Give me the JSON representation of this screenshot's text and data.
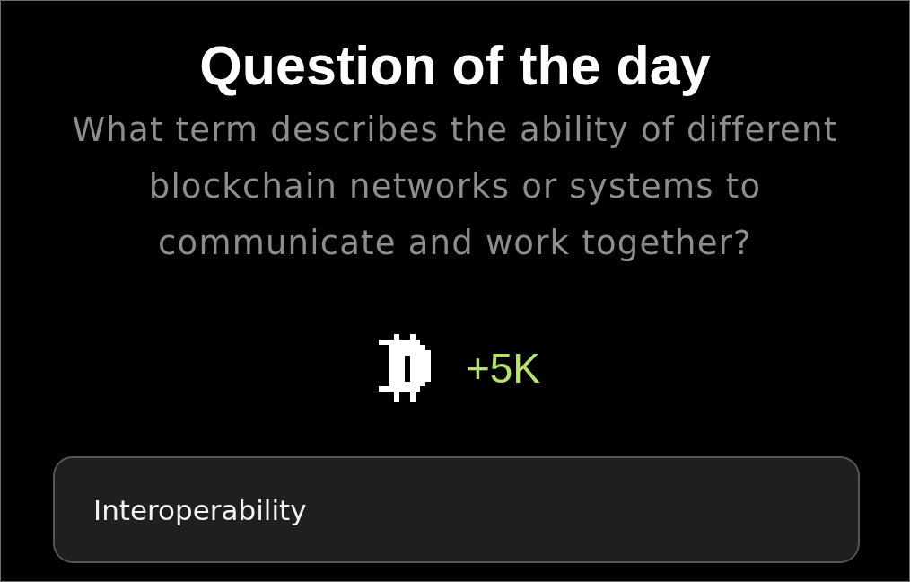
{
  "title": "Question of the day",
  "question": "What term describes the ability of different blockchain networks or systems to communicate and work together?",
  "reward": {
    "amount": "+5K"
  },
  "answer": {
    "value": "Interoperability"
  }
}
